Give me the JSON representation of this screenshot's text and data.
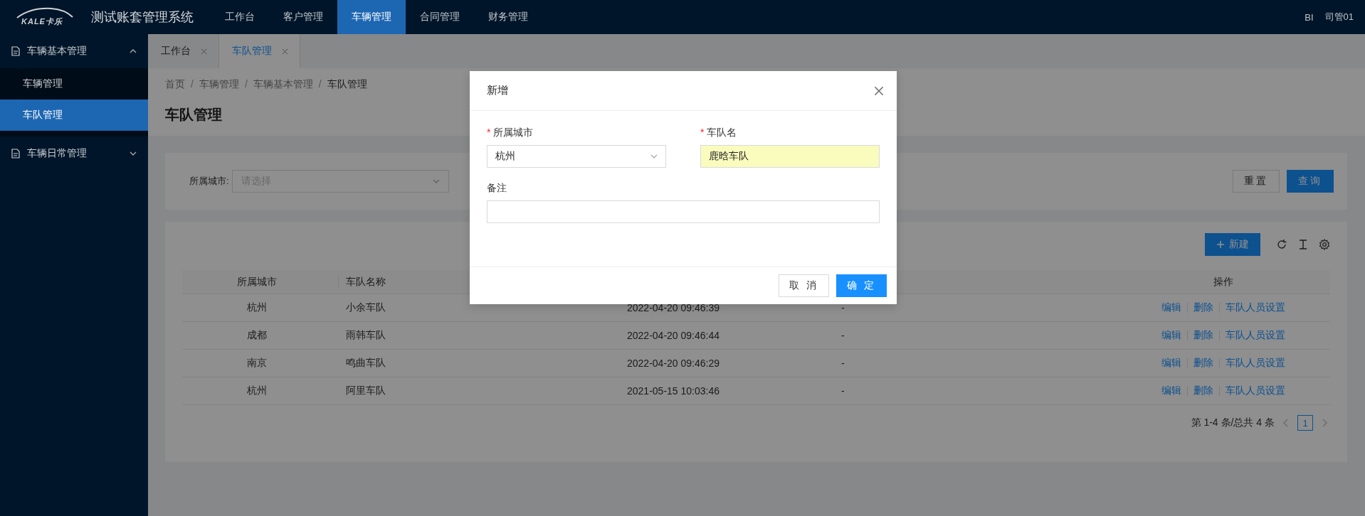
{
  "header": {
    "logo_text": "KALE卡乐",
    "title": "测试账套管理系统",
    "nav": [
      {
        "label": "工作台",
        "selected": false
      },
      {
        "label": "客户管理",
        "selected": false
      },
      {
        "label": "车辆管理",
        "selected": true
      },
      {
        "label": "合同管理",
        "selected": false
      },
      {
        "label": "财务管理",
        "selected": false
      }
    ],
    "right_links": [
      "BI",
      "司管01"
    ]
  },
  "sidebar": {
    "groups": [
      {
        "label": "车辆基本管理",
        "expanded": true,
        "children": [
          {
            "label": "车辆管理",
            "selected": false
          },
          {
            "label": "车队管理",
            "selected": true
          }
        ]
      },
      {
        "label": "车辆日常管理",
        "expanded": false
      }
    ]
  },
  "tabs": [
    {
      "label": "工作台",
      "selected": false
    },
    {
      "label": "车队管理",
      "selected": true
    }
  ],
  "breadcrumb": [
    "首页",
    "车辆管理",
    "车辆基本管理",
    "车队管理"
  ],
  "breadcrumb_separator": "/",
  "page_title": "车队管理",
  "filter": {
    "label": "所属城市:",
    "placeholder": "请选择",
    "buttons": [
      {
        "label": "重置",
        "kind": "default"
      },
      {
        "label": "查询",
        "kind": "primary"
      }
    ]
  },
  "toolbar": {
    "new_button": "新建"
  },
  "table": {
    "headers": [
      "所属城市",
      "车队名称"
    ],
    "actions_header": "操作",
    "rows": [
      {
        "city": "杭州",
        "name": "小余车队",
        "column_3": "2022-04-20 09:46:39",
        "column_4": "-",
        "actions": [
          "编辑",
          "删除",
          "车队人员设置"
        ]
      },
      {
        "city": "成都",
        "name": "雨韩车队",
        "column_3": "2022-04-20 09:46:44",
        "column_4": "-",
        "actions": [
          "编辑",
          "删除",
          "车队人员设置"
        ]
      },
      {
        "city": "南京",
        "name": "鸣曲车队",
        "column_3": "2022-04-20 09:46:29",
        "column_4": "-",
        "actions": [
          "编辑",
          "删除",
          "车队人员设置"
        ]
      },
      {
        "city": "杭州",
        "name": "阿里车队",
        "column_3": "2021-05-15 10:03:46",
        "column_4": "-",
        "actions": [
          "编辑",
          "删除",
          "车队人员设置"
        ]
      }
    ]
  },
  "pagination": {
    "summary": "第 1-4 条/总共 4 条",
    "pages": [
      {
        "label": "1",
        "selected": true
      }
    ]
  },
  "modal": {
    "title": "新增",
    "required_mark": "*",
    "fields": [
      {
        "kind": "select",
        "label": "所属城市",
        "required": true,
        "value": "杭州",
        "highlighted": false
      },
      {
        "kind": "text",
        "label": "车队名",
        "required": true,
        "value": "鹿晗车队",
        "highlighted": true
      },
      {
        "kind": "remark",
        "label": "备注",
        "required": false,
        "highlighted": false
      }
    ],
    "buttons": [
      {
        "label": "取 消",
        "kind": "default"
      },
      {
        "label": "确 定",
        "kind": "primary"
      }
    ]
  }
}
